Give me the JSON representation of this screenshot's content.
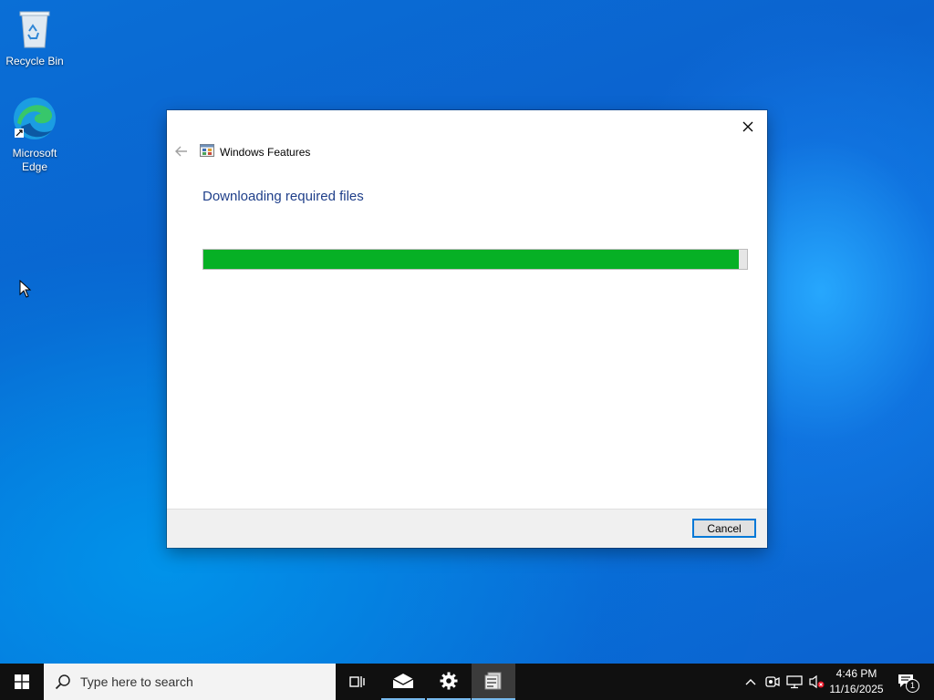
{
  "desktop": {
    "icons": [
      {
        "label": "Recycle Bin"
      },
      {
        "label": "Microsoft Edge"
      }
    ]
  },
  "dialog": {
    "window_title": "Windows Features",
    "heading": "Downloading required files",
    "progress_fraction": 0.985,
    "cancel_label": "Cancel",
    "progress_color": "#06b025",
    "heading_color": "#1f3f8a"
  },
  "taskbar": {
    "search_placeholder": "Type here to search",
    "clock_time": "4:46 PM",
    "clock_date": "11/16/2025",
    "notification_count": "1",
    "icons": [
      "windows-start-icon",
      "search-icon",
      "task-view-icon",
      "mail-icon",
      "settings-gear-icon",
      "windows-features-app-icon",
      "chevron-up-icon",
      "meet-now-icon",
      "network-icon",
      "volume-muted-icon",
      "notifications-icon"
    ]
  }
}
